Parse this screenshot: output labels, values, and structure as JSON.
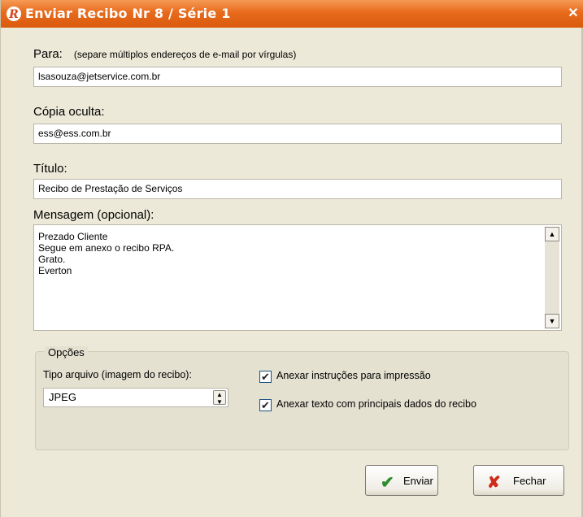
{
  "window": {
    "title": "Enviar Recibo Nr 8 / Série 1",
    "close_label": "✕",
    "accent_color": "#e86a1c"
  },
  "to": {
    "label": "Para:",
    "hint": "(separe múltiplos endereços de e-mail por vírgulas)",
    "value": "lsasouza@jetservice.com.br"
  },
  "bcc": {
    "label": "Cópia oculta:",
    "value": "ess@ess.com.br"
  },
  "subject": {
    "label": "Título:",
    "value": "Recibo de Prestação de Serviços"
  },
  "message": {
    "label": "Mensagem (opcional):",
    "lines": [
      "Prezado Cliente",
      "Segue em anexo o recibo RPA.",
      "Grato.",
      "Everton"
    ]
  },
  "options": {
    "group_label": "Opções",
    "file_type_label": "Tipo arquivo (imagem do recibo):",
    "file_type_value": "JPEG",
    "attach_instructions_label": "Anexar instruções para impressão",
    "attach_instructions_checked": true,
    "attach_text_label": "Anexar texto com principais dados do recibo",
    "attach_text_checked": true
  },
  "buttons": {
    "send_label": "Enviar",
    "send_icon": "checkmark-icon",
    "close_label": "Fechar",
    "close_icon": "x-icon"
  }
}
